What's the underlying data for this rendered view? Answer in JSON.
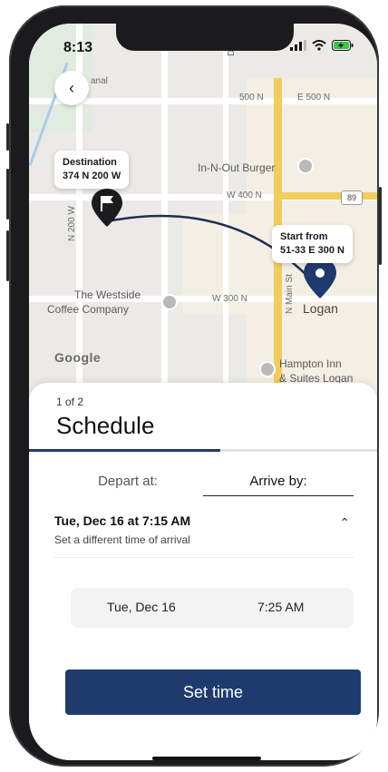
{
  "status_bar": {
    "time": "8:13"
  },
  "map": {
    "street_labels": [
      "500 N",
      "E 500 N",
      "W 400 N",
      "W 300 N",
      "N 200 W",
      "N Main St",
      "Dee"
    ],
    "poi_labels": [
      "In-N-Out Burger",
      "The Westside",
      "Coffee Company",
      "Hampton Inn",
      "& Suites Logan",
      "Logan",
      "anal"
    ],
    "route_badge": "89",
    "attribution": "Google",
    "destination": {
      "label": "Destination",
      "address": "374 N 200 W"
    },
    "start": {
      "label": "Start from",
      "address": "51-33 E 300 N"
    },
    "colors": {
      "route": "#1f2e52",
      "pin": "#1f3b6e",
      "major_road": "#f2cd5e"
    }
  },
  "sheet": {
    "step": "1 of 2",
    "title": "Schedule",
    "progress": 0.55,
    "tabs": [
      {
        "label": "Depart at:",
        "selected": false
      },
      {
        "label": "Arrive by:",
        "selected": true
      }
    ],
    "selection": {
      "main": "Tue, Dec 16 at 7:15 AM",
      "sub": "Set a different time of arrival"
    },
    "picker": {
      "date": "Tue, Dec 16",
      "time": "7:25 AM"
    },
    "set_button": "Set time"
  },
  "accent_color": "#1f3b6e"
}
